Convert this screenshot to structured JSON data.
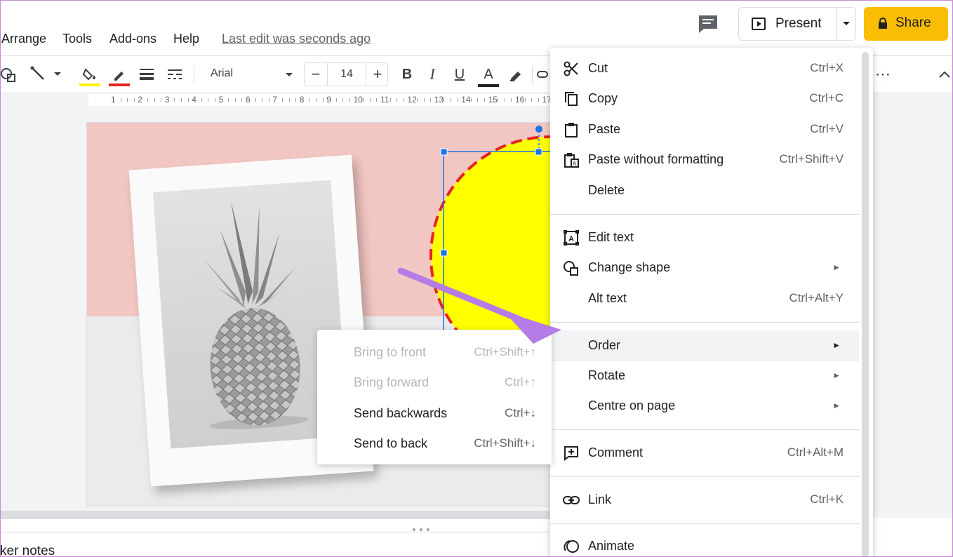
{
  "menubar": {
    "items": [
      "Arrange",
      "Tools",
      "Add-ons",
      "Help"
    ],
    "last_edit": "Last edit was seconds ago",
    "present_label": "Present",
    "share_label": "Share"
  },
  "toolbar": {
    "font_name": "Arial",
    "font_size": "14",
    "minus": "−",
    "plus": "+",
    "more": "⋯",
    "text_color": "#202124",
    "fill_color": "#fff200",
    "border_color": "#e52521"
  },
  "ruler": {
    "ticks": [
      "1",
      "2",
      "3",
      "4",
      "5",
      "6",
      "7",
      "8",
      "9",
      "10",
      "11",
      "12",
      "13",
      "14",
      "15",
      "16",
      "17"
    ]
  },
  "context_menu": {
    "items": [
      {
        "label": "Cut",
        "shortcut": "Ctrl+X",
        "icon": "scissors-icon"
      },
      {
        "label": "Copy",
        "shortcut": "Ctrl+C",
        "icon": "copy-icon"
      },
      {
        "label": "Paste",
        "shortcut": "Ctrl+V",
        "icon": "clipboard-icon"
      },
      {
        "label": "Paste without formatting",
        "shortcut": "Ctrl+Shift+V",
        "icon": "paste-plain-icon"
      },
      {
        "label": "Delete",
        "shortcut": "",
        "icon": ""
      },
      {
        "label": "Edit text",
        "shortcut": "",
        "icon": "edit-text-icon"
      },
      {
        "label": "Change shape",
        "shortcut": "",
        "icon": "shape-icon",
        "submenu": true
      },
      {
        "label": "Alt text",
        "shortcut": "Ctrl+Alt+Y",
        "icon": ""
      },
      {
        "label": "Order",
        "shortcut": "",
        "icon": "",
        "submenu": true,
        "highlighted": true
      },
      {
        "label": "Rotate",
        "shortcut": "",
        "icon": "",
        "submenu": true
      },
      {
        "label": "Centre on page",
        "shortcut": "",
        "icon": "",
        "submenu": true
      },
      {
        "label": "Comment",
        "shortcut": "Ctrl+Alt+M",
        "icon": "add-comment-icon"
      },
      {
        "label": "Link",
        "shortcut": "Ctrl+K",
        "icon": "link-icon"
      },
      {
        "label": "Animate",
        "shortcut": "",
        "icon": "animate-icon"
      }
    ]
  },
  "order_submenu": {
    "items": [
      {
        "label": "Bring to front",
        "shortcut": "Ctrl+Shift+↑",
        "enabled": false
      },
      {
        "label": "Bring forward",
        "shortcut": "Ctrl+↑",
        "enabled": false
      },
      {
        "label": "Send backwards",
        "shortcut": "Ctrl+↓",
        "enabled": true
      },
      {
        "label": "Send to back",
        "shortcut": "Ctrl+Shift+↓",
        "enabled": true
      }
    ]
  },
  "speaker_notes": {
    "label": "ker notes"
  },
  "colors": {
    "share_bg": "#fbbc04",
    "circle_fill": "#ffff00",
    "circle_border": "#e52521",
    "selection": "#1a73e8",
    "slide_pink": "#f2c6c2",
    "annotation_arrow": "#b57be6"
  }
}
